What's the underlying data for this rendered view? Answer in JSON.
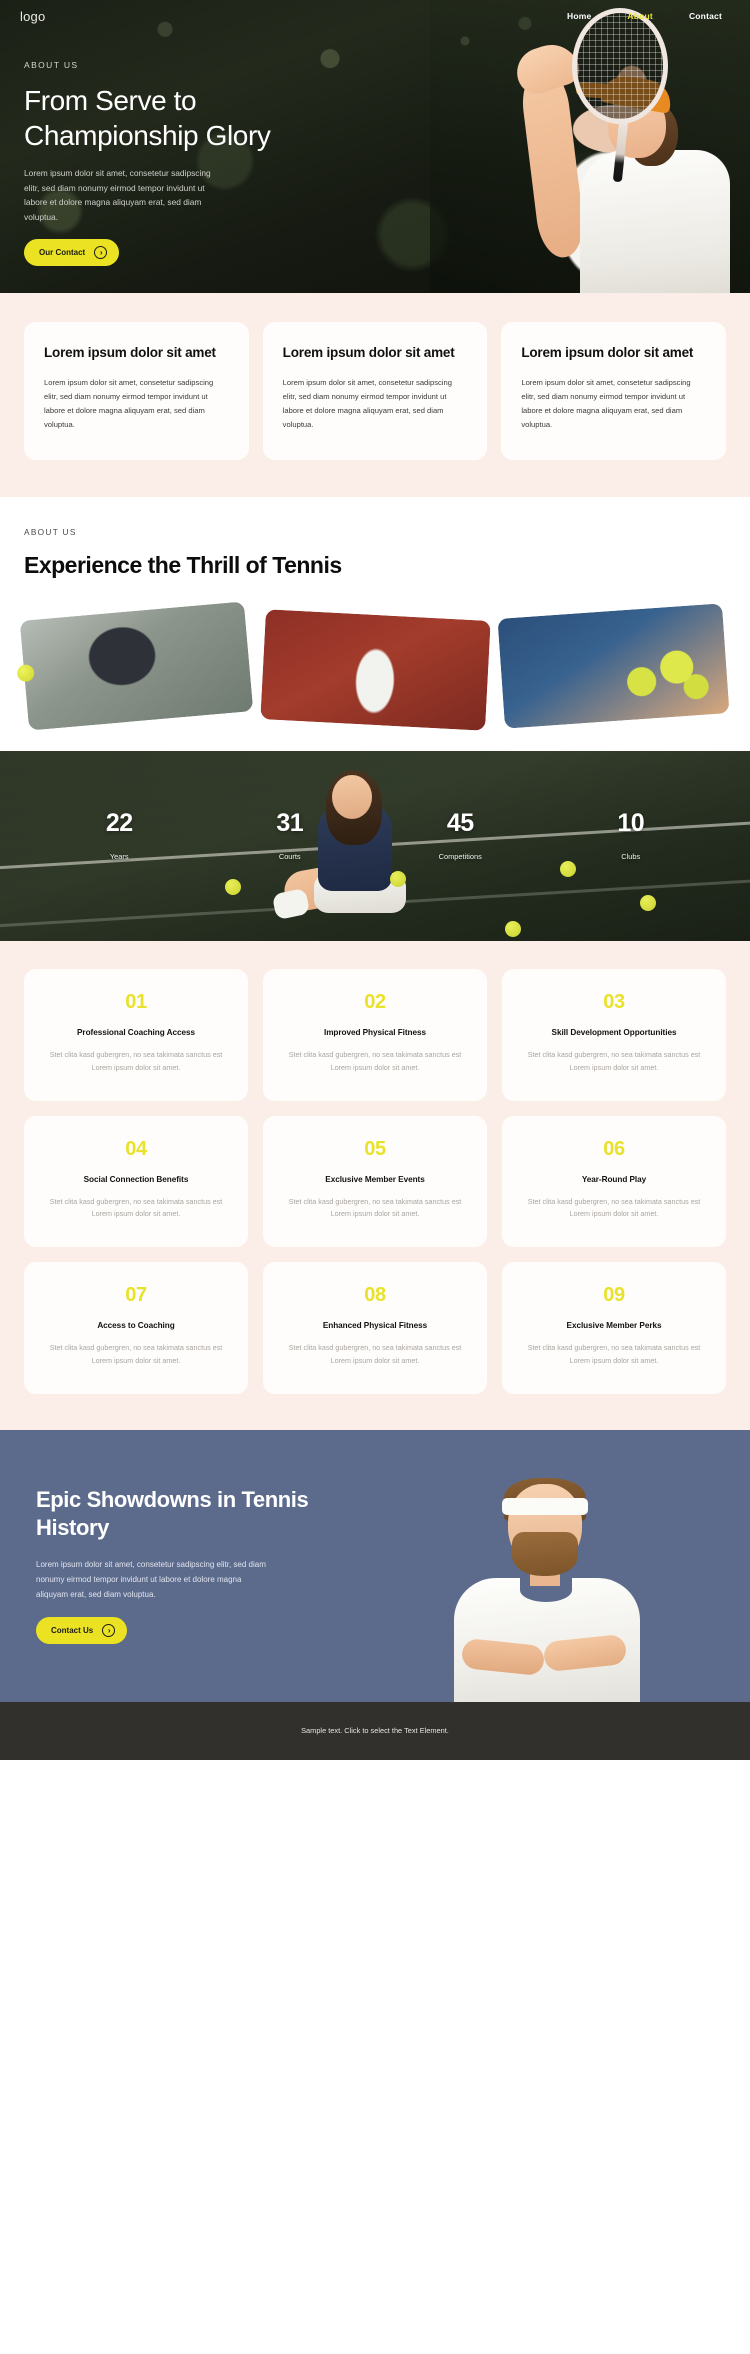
{
  "nav": {
    "logo": "logo",
    "links": [
      {
        "label": "Home",
        "active": false
      },
      {
        "label": "About",
        "active": true
      },
      {
        "label": "Contact",
        "active": false
      }
    ]
  },
  "hero": {
    "eyebrow": "ABOUT US",
    "title": "From Serve to Championship Glory",
    "subtitle": "Lorem ipsum dolor sit amet, consetetur sadipscing elitr, sed diam nonumy eirmod tempor invidunt ut labore et dolore magna aliquyam erat, sed diam voluptua.",
    "cta_label": "Our Contact",
    "cta_icon": "arrow-right-circle-icon",
    "accent_color": "#eae222"
  },
  "cards_section": {
    "background_color": "#fbeee9",
    "cards": [
      {
        "title": "Lorem ipsum dolor sit amet",
        "body": "Lorem ipsum dolor sit amet, consetetur sadipscing elitr, sed diam nonumy eirmod tempor invidunt ut labore et dolore magna aliquyam erat, sed diam voluptua."
      },
      {
        "title": "Lorem ipsum dolor sit amet",
        "body": "Lorem ipsum dolor sit amet, consetetur sadipscing elitr, sed diam nonumy eirmod tempor invidunt ut labore et dolore magna aliquyam erat, sed diam voluptua."
      },
      {
        "title": "Lorem ipsum dolor sit amet",
        "body": "Lorem ipsum dolor sit amet, consetetur sadipscing elitr, sed diam nonumy eirmod tempor invidunt ut labore et dolore magna aliquyam erat, sed diam voluptua."
      }
    ]
  },
  "thrill": {
    "eyebrow": "ABOUT US",
    "title": "Experience the Thrill of Tennis",
    "gallery": [
      {
        "name": "player-serving-photo"
      },
      {
        "name": "player-legs-clay-court-photo"
      },
      {
        "name": "player-with-tennis-balls-photo"
      }
    ]
  },
  "stats": {
    "items": [
      {
        "number": "22",
        "label": "Years"
      },
      {
        "number": "31",
        "label": "Courts"
      },
      {
        "number": "45",
        "label": "Competitions"
      },
      {
        "number": "10",
        "label": "Clubs"
      }
    ]
  },
  "features": {
    "background_color": "#fbeee9",
    "number_color": "#e9e22c",
    "items": [
      {
        "num": "01",
        "title": "Professional Coaching Access",
        "desc": "Stet clita kasd gubergren, no sea takimata sanctus est Lorem ipsum dolor sit amet."
      },
      {
        "num": "02",
        "title": "Improved Physical Fitness",
        "desc": "Stet clita kasd gubergren, no sea takimata sanctus est Lorem ipsum dolor sit amet."
      },
      {
        "num": "03",
        "title": "Skill Development Opportunities",
        "desc": "Stet clita kasd gubergren, no sea takimata sanctus est Lorem ipsum dolor sit amet."
      },
      {
        "num": "04",
        "title": "Social Connection Benefits",
        "desc": "Stet clita kasd gubergren, no sea takimata sanctus est Lorem ipsum dolor sit amet."
      },
      {
        "num": "05",
        "title": "Exclusive Member Events",
        "desc": "Stet clita kasd gubergren, no sea takimata sanctus est Lorem ipsum dolor sit amet."
      },
      {
        "num": "06",
        "title": "Year-Round Play",
        "desc": "Stet clita kasd gubergren, no sea takimata sanctus est Lorem ipsum dolor sit amet."
      },
      {
        "num": "07",
        "title": "Access to Coaching",
        "desc": "Stet clita kasd gubergren, no sea takimata sanctus est Lorem ipsum dolor sit amet."
      },
      {
        "num": "08",
        "title": "Enhanced Physical Fitness",
        "desc": "Stet clita kasd gubergren, no sea takimata sanctus est Lorem ipsum dolor sit amet."
      },
      {
        "num": "09",
        "title": "Exclusive Member Perks",
        "desc": "Stet clita kasd gubergren, no sea takimata sanctus est Lorem ipsum dolor sit amet."
      }
    ]
  },
  "epic": {
    "background_color": "#5c6b8c",
    "title": "Epic Showdowns in Tennis History",
    "subtitle": "Lorem ipsum dolor sit amet, consetetur sadipscing elitr, sed diam nonumy eirmod tempor invidunt ut labore et dolore magna aliquyam erat, sed diam voluptua.",
    "cta_label": "Contact Us",
    "cta_icon": "arrow-right-circle-icon"
  },
  "footer": {
    "text": "Sample text. Click to select the Text Element.",
    "background_color": "#32302d"
  }
}
